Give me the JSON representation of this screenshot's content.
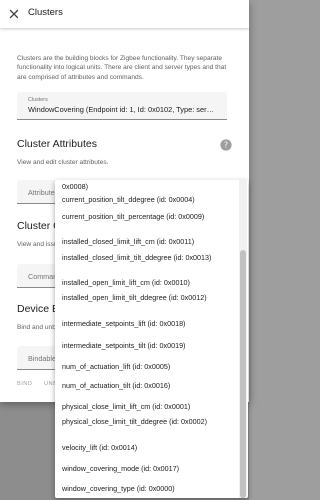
{
  "dialog": {
    "title": "Clusters",
    "intro": "Clusters are the building blocks for Zigbee functionality. They separate functionality into logical units. There are client and server types and that are comprised of attributes and commands.",
    "cluster_field": {
      "label": "Clusters",
      "value": "WindowCovering (Endpoint id: 1, Id: 0x0102, Type: server)"
    },
    "attributes": {
      "title": "Cluster Attributes",
      "description": "View and edit cluster attributes.",
      "input_label": "Attribute"
    },
    "commands": {
      "title": "Cluster Commands",
      "description": "View and issue cluster commands.",
      "input_label": "Commands"
    },
    "bindings": {
      "title": "Device Bindings",
      "description": "Bind and unbind devices.",
      "input_label": "Bindable devices",
      "bind_button": "BIND",
      "unbind_button": "UNBIND"
    }
  },
  "dropdown": {
    "options": [
      "0x0008)",
      "current_position_tilt_ddegree (id: 0x0004)",
      "current_position_tilt_percentage (id: 0x0009)",
      "installed_closed_limit_lift_cm (id: 0x0011)",
      "installed_closed_limit_tilt_ddegree (id: 0x0013)",
      "installed_open_limit_lift_cm (id: 0x0010)",
      "installed_open_limit_tilt_ddegree (id: 0x0012)",
      "intermediate_setpoints_lift (id: 0x0018)",
      "intermediate_setpoints_tilt (id: 0x0019)",
      "num_of_actuation_lift (id: 0x0005)",
      "num_of_actuation_tilt (id: 0x0016)",
      "physical_close_limit_lift_cm (id: 0x0001)",
      "physical_close_limit_tilt_ddegree (id: 0x0002)",
      "velocity_lift (id: 0x0014)",
      "window_covering_mode (id: 0x0017)",
      "window_covering_type (id: 0x0000)"
    ]
  },
  "icons": {
    "close": "close-icon",
    "help": "help-icon"
  },
  "colors": {
    "text_primary": "#212121",
    "text_secondary": "#616161",
    "field_bg": "#f5f5f5",
    "disabled": "#9e9e9e",
    "backdrop": "#8d8d8d"
  }
}
